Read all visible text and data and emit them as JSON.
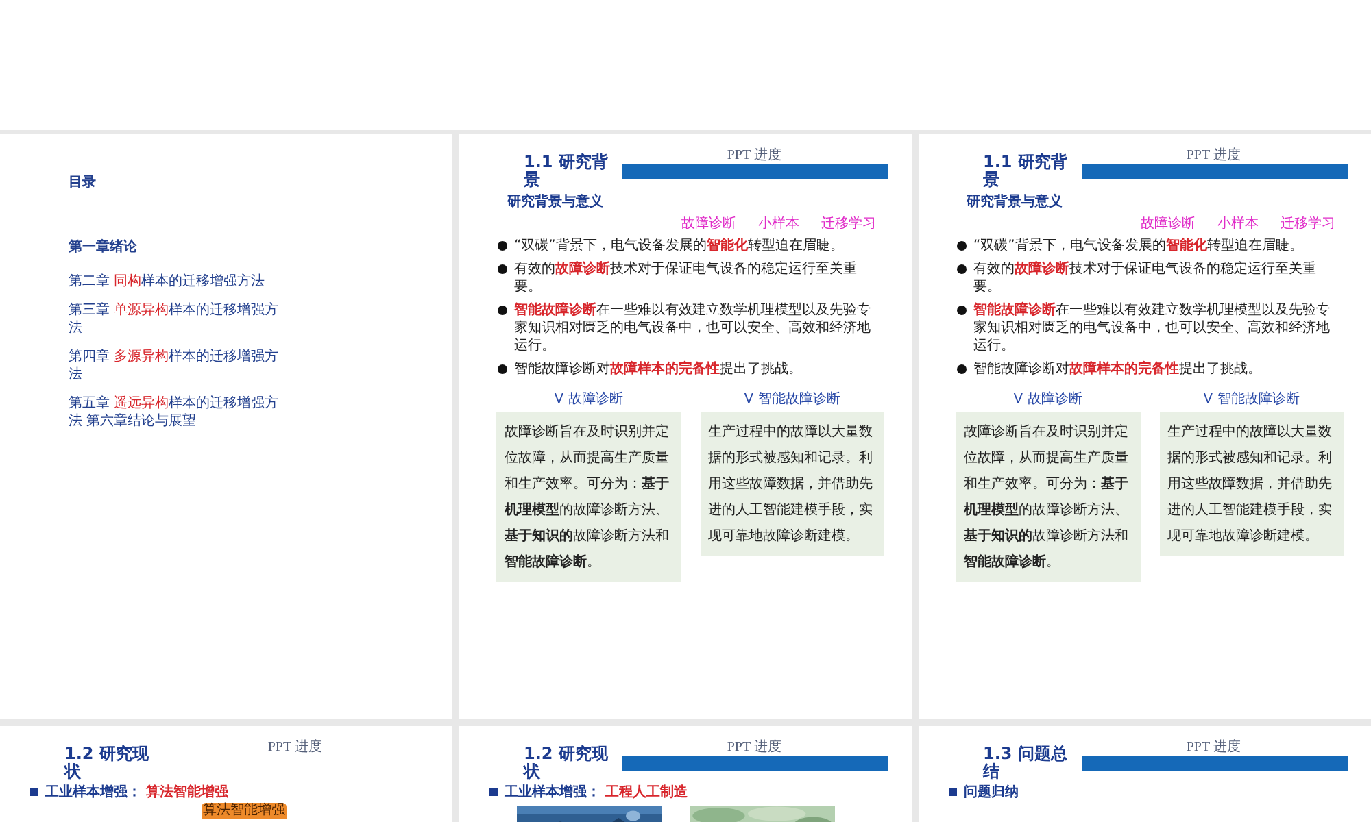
{
  "slides": [
    {
      "kind": "toc",
      "heading": "目录",
      "items": [
        {
          "bold": true,
          "parts": [
            {
              "text": "第一章绪论",
              "accent": false
            }
          ]
        },
        {
          "bold": false,
          "parts": [
            {
              "text": "第二章 ",
              "accent": false
            },
            {
              "text": "同构",
              "accent": true
            },
            {
              "text": "样本的迁移增强方法",
              "accent": false
            }
          ]
        },
        {
          "bold": false,
          "parts": [
            {
              "text": "第三章 ",
              "accent": false
            },
            {
              "text": "单源异构",
              "accent": true
            },
            {
              "text": "样本的迁移增强方法",
              "accent": false
            }
          ]
        },
        {
          "bold": false,
          "parts": [
            {
              "text": "第四章 ",
              "accent": false
            },
            {
              "text": "多源异构",
              "accent": true
            },
            {
              "text": "样本的迁移增强方法",
              "accent": false
            }
          ]
        },
        {
          "bold": false,
          "parts": [
            {
              "text": "第五章 ",
              "accent": false
            },
            {
              "text": "遥远异构",
              "accent": true
            },
            {
              "text": "样本的迁移增强方法 第六章结论与展望",
              "accent": false
            }
          ]
        }
      ]
    },
    {
      "kind": "section",
      "title": "1.1 研究背景",
      "progress_label": "PPT 进度",
      "band": true,
      "subtitle": "研究背景与意义",
      "tags": [
        "故障诊断",
        "小样本",
        "迁移学习"
      ],
      "bullets": [
        {
          "kind": "dot",
          "parts": [
            {
              "text": "“双碳”背景下，电气设备发展的",
              "accent": false
            },
            {
              "text": "智能化",
              "accent": true
            },
            {
              "text": "转型迫在眉睫。",
              "accent": false
            }
          ]
        },
        {
          "kind": "dot",
          "parts": [
            {
              "text": "有效的",
              "accent": false
            },
            {
              "text": "故障诊断",
              "accent": true
            },
            {
              "text": "技术对于保证电气设备的稳定运行至关重要。",
              "accent": false
            }
          ]
        },
        {
          "kind": "dot",
          "parts": [
            {
              "text": "智能故障诊断",
              "accent": true
            },
            {
              "text": "在一些难以有效建立数学机理模型以及先验专家知识相对匮乏的电气设备中，也可以安全、高效和经济地运行。",
              "accent": false
            }
          ]
        },
        {
          "kind": "dot",
          "parts": [
            {
              "text": "智能故障诊断对",
              "accent": false
            },
            {
              "text": "故障样本的完备性",
              "accent": true
            },
            {
              "text": "提出了挑战。",
              "accent": false
            }
          ]
        }
      ],
      "columns": [
        {
          "heading": "V  故障诊断",
          "text": "故障诊断旨在及时识别并定位故障，从而提高生产质量和生产效率。可分为：**基于机理模型**的故障诊断方法、**基于知识的**故障诊断方法和**智能故障诊断**。"
        },
        {
          "heading": "V  智能故障诊断",
          "text": "生产过程中的故障以大量数据的形式被感知和记录。利用这些故障数据，并借助先进的人工智能建模手段，实现可靠地故障诊断建模。"
        }
      ]
    },
    {
      "kind": "section",
      "title": "1.1 研究背景",
      "progress_label": "PPT 进度",
      "band": true,
      "subtitle": "研究背景与意义",
      "tags": [
        "故障诊断",
        "小样本",
        "迁移学习"
      ],
      "bullets": [
        {
          "kind": "dot",
          "parts": [
            {
              "text": "“双碳”背景下，电气设备发展的",
              "accent": false
            },
            {
              "text": "智能化",
              "accent": true
            },
            {
              "text": "转型迫在眉睫。",
              "accent": false
            }
          ]
        },
        {
          "kind": "dot",
          "parts": [
            {
              "text": "有效的",
              "accent": false
            },
            {
              "text": "故障诊断",
              "accent": true
            },
            {
              "text": "技术对于保证电气设备的稳定运行至关重要。",
              "accent": false
            }
          ]
        },
        {
          "kind": "dot",
          "parts": [
            {
              "text": "智能故障诊断",
              "accent": true
            },
            {
              "text": "在一些难以有效建立数学机理模型以及先验专家知识相对匮乏的电气设备中，也可以安全、高效和经济地运行。",
              "accent": false
            }
          ]
        },
        {
          "kind": "dot",
          "parts": [
            {
              "text": "智能故障诊断对",
              "accent": false
            },
            {
              "text": "故障样本的完备性",
              "accent": true
            },
            {
              "text": "提出了挑战。",
              "accent": false
            }
          ]
        }
      ],
      "columns": [
        {
          "heading": "V  故障诊断",
          "text": "故障诊断旨在及时识别并定位故障，从而提高生产质量和生产效率。可分为：**基于机理模型**的故障诊断方法、**基于知识的**故障诊断方法和**智能故障诊断**。"
        },
        {
          "heading": "V  智能故障诊断",
          "text": "生产过程中的故障以大量数据的形式被感知和记录。利用这些故障数据，并借助先进的人工智能建模手段，实现可靠地故障诊断建模。"
        }
      ]
    },
    {
      "kind": "section",
      "title": "1.2 研究现状",
      "progress_label": "PPT 进度",
      "band": false,
      "bullets": [
        {
          "kind": "square",
          "parts": [
            {
              "text": "工业样本增强： ",
              "accent": false
            },
            {
              "text": "算法智能增强",
              "accent": true
            }
          ]
        }
      ],
      "callout": "算法智能增强"
    },
    {
      "kind": "section",
      "title": "1.2 研究现状",
      "progress_label": "PPT 进度",
      "band": true,
      "bullets": [
        {
          "kind": "square",
          "parts": [
            {
              "text": "工业样本增强： ",
              "accent": false
            },
            {
              "text": "工程人工制造",
              "accent": true
            }
          ]
        }
      ],
      "figures": [
        {
          "kind": "picture"
        },
        {
          "kind": "picture"
        }
      ]
    },
    {
      "kind": "section",
      "title": "1.3 问题总结",
      "progress_label": "PPT 进度",
      "band": true,
      "bullets": [
        {
          "kind": "square",
          "parts": [
            {
              "text": "问题归纳",
              "accent": false
            }
          ]
        }
      ]
    }
  ]
}
